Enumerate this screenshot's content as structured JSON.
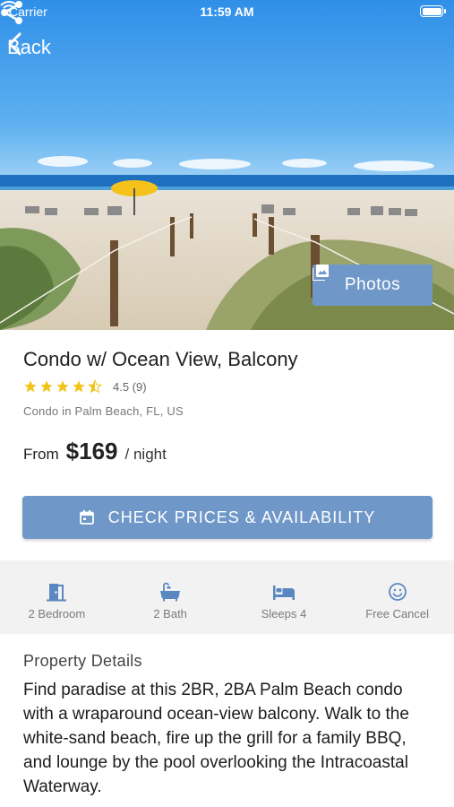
{
  "status": {
    "carrier": "Carrier",
    "time": "11:59 AM"
  },
  "nav": {
    "back_label": "Back"
  },
  "hero": {
    "photos_label": "Photos"
  },
  "listing": {
    "title": "Condo w/ Ocean View, Balcony",
    "rating": "4.5 (9)",
    "rating_value": 4.5,
    "location": "Condo in Palm Beach, FL, US",
    "price_prefix": "From",
    "price": "$169",
    "price_unit": "/ night"
  },
  "cta": {
    "label": "CHECK PRICES & AVAILABILITY"
  },
  "amenities": [
    {
      "label": "2 Bedroom",
      "icon": "door-icon"
    },
    {
      "label": "2 Bath",
      "icon": "bathtub-icon"
    },
    {
      "label": "Sleeps 4",
      "icon": "bed-icon"
    },
    {
      "label": "Free Cancel",
      "icon": "smile-icon"
    }
  ],
  "details": {
    "heading": "Property Details",
    "text": "Find paradise at this 2BR, 2BA Palm Beach condo with a wraparound ocean-view balcony. Walk to the white-sand beach, fire up the grill for a family BBQ, and lounge by the pool overlooking the Intracoastal Waterway."
  },
  "colors": {
    "accent": "#6f98c8",
    "star": "#f0c419",
    "amenity_icon": "#5b87c0"
  }
}
